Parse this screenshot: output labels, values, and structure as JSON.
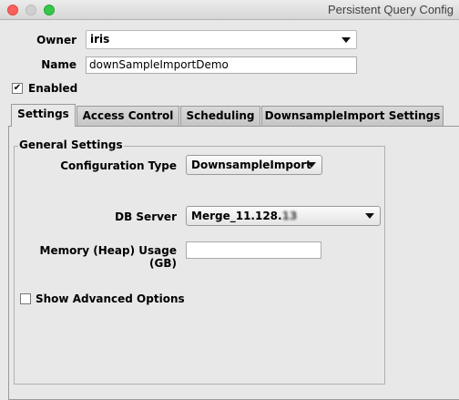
{
  "window": {
    "title": "Persistent Query Config"
  },
  "owner": {
    "label": "Owner",
    "value": "iris"
  },
  "name": {
    "label": "Name",
    "value": "downSampleImportDemo"
  },
  "enabled": {
    "label": "Enabled",
    "checked": true
  },
  "tabs": [
    {
      "label": "Settings",
      "active": true
    },
    {
      "label": "Access Control",
      "active": false
    },
    {
      "label": "Scheduling",
      "active": false
    },
    {
      "label": "DownsampleImport Settings",
      "active": false
    }
  ],
  "general": {
    "title": "General Settings",
    "config_type_label": "Configuration Type",
    "config_type_value": "DownsampleImport",
    "db_server_label": "DB Server",
    "db_server_value": "Merge_11.128.",
    "db_server_value_obscured": "13",
    "memory_label": "Memory (Heap) Usage (GB)",
    "memory_value": "",
    "show_advanced_label": "Show Advanced Options",
    "show_advanced_checked": false
  }
}
